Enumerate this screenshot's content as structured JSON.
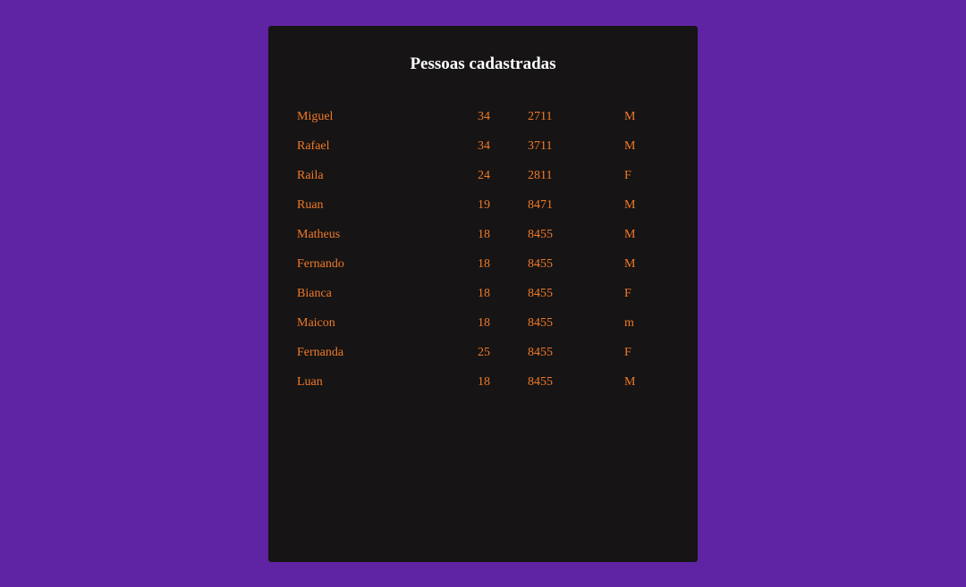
{
  "page": {
    "title": "Pessoas cadastradas"
  },
  "people": [
    {
      "name": "Miguel",
      "age": "34",
      "code": "2711",
      "sex": "M"
    },
    {
      "name": "Rafael",
      "age": "34",
      "code": "3711",
      "sex": "M"
    },
    {
      "name": "Raila",
      "age": "24",
      "code": "2811",
      "sex": "F"
    },
    {
      "name": "Ruan",
      "age": "19",
      "code": "8471",
      "sex": "M"
    },
    {
      "name": "Matheus",
      "age": "18",
      "code": "8455",
      "sex": "M"
    },
    {
      "name": "Fernando",
      "age": "18",
      "code": "8455",
      "sex": "M"
    },
    {
      "name": "Bianca",
      "age": "18",
      "code": "8455",
      "sex": "F"
    },
    {
      "name": "Maicon",
      "age": "18",
      "code": "8455",
      "sex": "m"
    },
    {
      "name": "Fernanda",
      "age": "25",
      "code": "8455",
      "sex": "F"
    },
    {
      "name": "Luan",
      "age": "18",
      "code": "8455",
      "sex": "M"
    }
  ],
  "colors": {
    "background": "#5f24a3",
    "card": "#161414",
    "title": "#ffffff",
    "text": "#f07a2a"
  }
}
